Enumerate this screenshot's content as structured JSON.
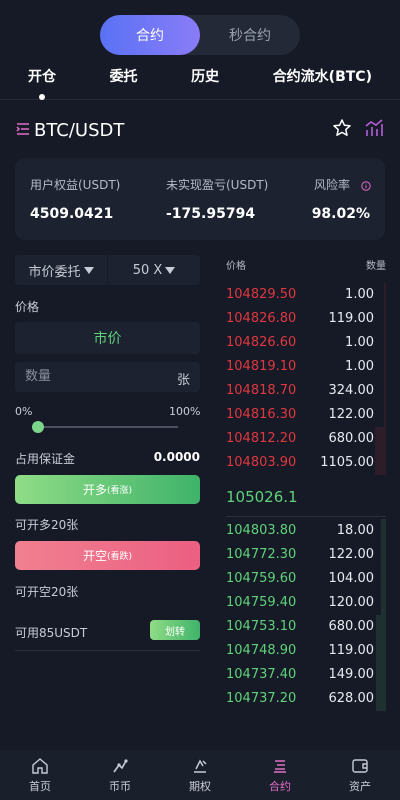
{
  "mode_switch": {
    "contract": "合约",
    "seconds_contract": "秒合约"
  },
  "tabs": [
    "开仓",
    "委托",
    "历史",
    "合约流水(BTC)"
  ],
  "pair": {
    "name": "BTC/USDT",
    "icons": [
      "menu-indent-icon",
      "star-icon",
      "chart-icon"
    ]
  },
  "account": {
    "equity_label": "用户权益(USDT)",
    "equity_value": "4509.0421",
    "pnl_label": "未实现盈亏(USDT)",
    "pnl_value": "-175.95794",
    "risk_label": "风险率",
    "risk_value": "98.02%"
  },
  "order_form": {
    "order_type": "市价委托",
    "leverage": "50 X",
    "price_label": "价格",
    "price_value": "市价",
    "qty_placeholder": "数量",
    "qty_unit": "张",
    "slider_min": "0%",
    "slider_max": "100%",
    "slider_value": 0,
    "margin_label": "占用保证金",
    "margin_value": "0.0000",
    "long_label": "开多",
    "long_sub": "(看涨)",
    "can_long": "可开多20张",
    "short_label": "开空",
    "short_sub": "(看跌)",
    "can_short": "可开空20张",
    "available": "可用85USDT",
    "transfer_label": "划转"
  },
  "order_book": {
    "price_header": "价格",
    "qty_header": "数量",
    "asks": [
      {
        "price": "104829.50",
        "qty": "1.00",
        "depth": 0.01
      },
      {
        "price": "104826.80",
        "qty": "119.00",
        "depth": 0.01
      },
      {
        "price": "104826.60",
        "qty": "1.00",
        "depth": 0.01
      },
      {
        "price": "104819.10",
        "qty": "1.00",
        "depth": 0.01
      },
      {
        "price": "104818.70",
        "qty": "324.00",
        "depth": 0.01
      },
      {
        "price": "104816.30",
        "qty": "122.00",
        "depth": 0.01
      },
      {
        "price": "104812.20",
        "qty": "680.00",
        "depth": 0.07
      },
      {
        "price": "104803.90",
        "qty": "1105.00",
        "depth": 0.07
      }
    ],
    "mid_price": "105026.1",
    "bids": [
      {
        "price": "104803.80",
        "qty": "18.00",
        "depth": 0.03
      },
      {
        "price": "104772.30",
        "qty": "122.00",
        "depth": 0.03
      },
      {
        "price": "104759.60",
        "qty": "104.00",
        "depth": 0.03
      },
      {
        "price": "104759.40",
        "qty": "120.00",
        "depth": 0.03
      },
      {
        "price": "104753.10",
        "qty": "680.00",
        "depth": 0.06
      },
      {
        "price": "104748.90",
        "qty": "119.00",
        "depth": 0.06
      },
      {
        "price": "104737.40",
        "qty": "149.00",
        "depth": 0.06
      },
      {
        "price": "104737.20",
        "qty": "628.00",
        "depth": 0.06
      }
    ]
  },
  "bottom_nav": [
    {
      "label": "首页",
      "icon": "home-icon"
    },
    {
      "label": "币币",
      "icon": "coin-trade-icon"
    },
    {
      "label": "期权",
      "icon": "option-icon"
    },
    {
      "label": "合约",
      "icon": "contract-icon",
      "active": true
    },
    {
      "label": "资产",
      "icon": "wallet-icon"
    }
  ],
  "colors": {
    "accent": "#5a72f5",
    "up": "#5fd27a",
    "down": "#e0383f",
    "nav_active": "#e26ec7"
  }
}
